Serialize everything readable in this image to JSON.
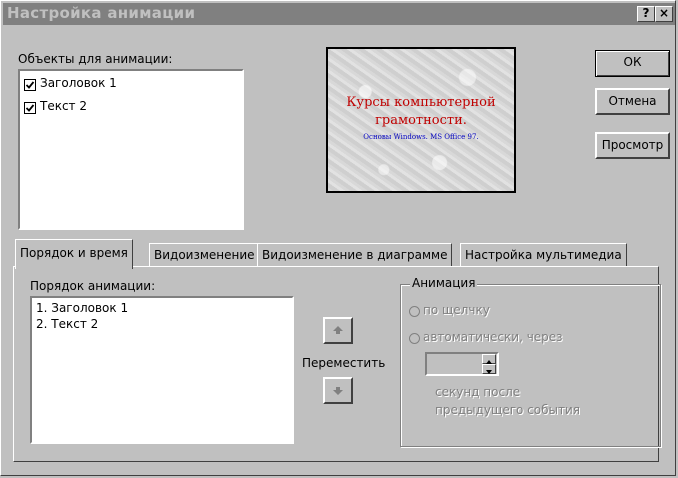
{
  "window": {
    "title": "Настройка анимации",
    "help_label": "?",
    "close_label": "×"
  },
  "objects": {
    "label": "Объекты для анимации:",
    "items": [
      {
        "label": "Заголовок 1",
        "checked": true
      },
      {
        "label": "Текст 2",
        "checked": true
      }
    ]
  },
  "preview": {
    "line1": "Курсы компьютерной",
    "line2": "грамотности.",
    "line3": "Основы Windows. MS Office 97."
  },
  "buttons": {
    "ok": "ОК",
    "cancel": "Отмена",
    "preview": "Просмотр"
  },
  "tabs": [
    {
      "label": "Порядок и время",
      "active": true
    },
    {
      "label": "Видоизменение",
      "active": false
    },
    {
      "label": "Видоизменение в диаграмме",
      "active": false
    },
    {
      "label": "Настройка мультимедиа",
      "active": false
    }
  ],
  "order": {
    "label": "Порядок анимации:",
    "items": [
      "1. Заголовок 1",
      "2. Текст 2"
    ],
    "move_label": "Переместить"
  },
  "animation": {
    "group_label": "Анимация",
    "on_click": "по щелчку",
    "auto": "автоматически, через",
    "seconds_value": "",
    "after_line1": "секунд после",
    "after_line2": "предыдущего события"
  }
}
